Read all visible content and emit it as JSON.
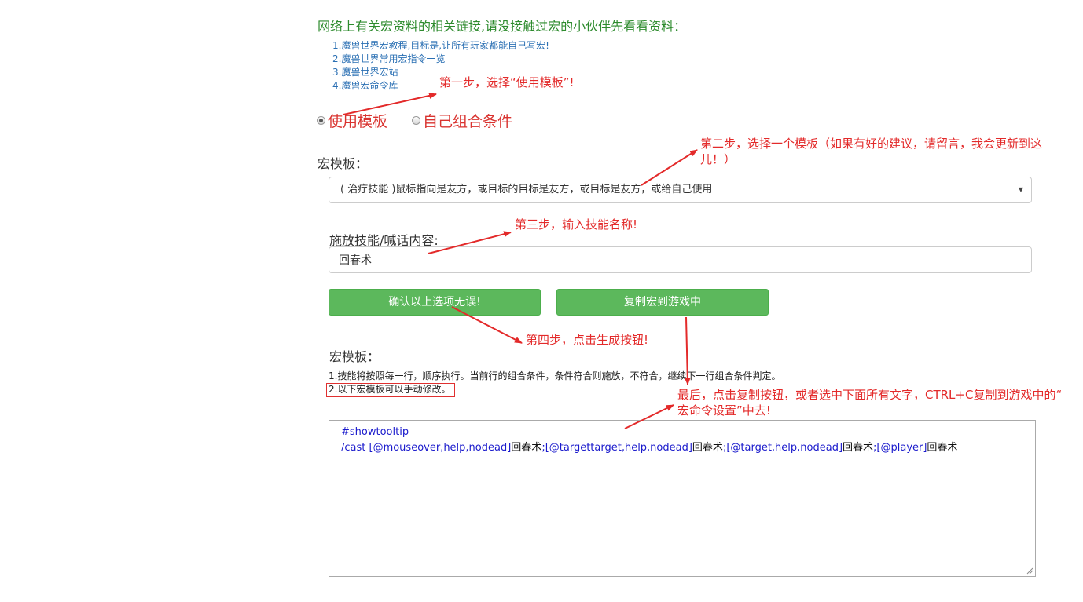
{
  "intro": {
    "heading": "网络上有关宏资料的相关链接,请没接触过宏的小伙伴先看看资料：",
    "links": [
      "1.魔兽世界宏教程,目标是,让所有玩家都能自己写宏!",
      "2.魔兽世界常用宏指令一览",
      "3.魔兽世界宏站",
      "4.魔兽宏命令库"
    ]
  },
  "mode": {
    "use_template": "使用模板",
    "custom_conditions": "自己组合条件",
    "selected": "use_template"
  },
  "template_select": {
    "label": "宏模板：",
    "value": "( 治疗技能 )鼠标指向是友方，或目标的目标是友方，或目标是友方，或给自己使用"
  },
  "skill_input": {
    "label": "施放技能/喊话内容:",
    "value": "回春术"
  },
  "buttons": {
    "confirm": "确认以上选项无误!",
    "copy": "复制宏到游戏中"
  },
  "output": {
    "label": "宏模板：",
    "note1": "1.技能将按照每一行，顺序执行。当前行的组合条件，条件符合则施放，不符合，继续下一行组合条件判定。",
    "note2": "2.以下宏模板可以手动修改。",
    "line1": "#showtooltip",
    "line2_parts": [
      {
        "text": "/cast [@mouseover,help,nodead]",
        "color": "#1a1acc"
      },
      {
        "text": "回春术",
        "color": "#111111"
      },
      {
        "text": ";[@targettarget,help,nodead]",
        "color": "#1a1acc"
      },
      {
        "text": "回春术",
        "color": "#111111"
      },
      {
        "text": ";[@target,help,nodead]",
        "color": "#1a1acc"
      },
      {
        "text": "回春术",
        "color": "#111111"
      },
      {
        "text": ";[@player]",
        "color": "#1a1acc"
      },
      {
        "text": "回春术",
        "color": "#111111"
      }
    ]
  },
  "annotations": {
    "step1": "第一步，选择“使用模板”!",
    "step2_line1": "第二步，选择一个模板（如果有好的建议，请留言，我会更新到这",
    "step2_line2": "儿！）",
    "step3": "第三步，输入技能名称!",
    "step4": "第四步，点击生成按钮!",
    "final_line1": "最后，点击复制按钮，或者选中下面所有文字，CTRL+C复制到游戏中的“",
    "final_line2": "宏命令设置”中去!"
  },
  "colors": {
    "annotation_red": "#e32a2a",
    "button_green": "#5cb85c",
    "link_blue": "#2a6fb3",
    "intro_green": "#2e8b2e"
  }
}
